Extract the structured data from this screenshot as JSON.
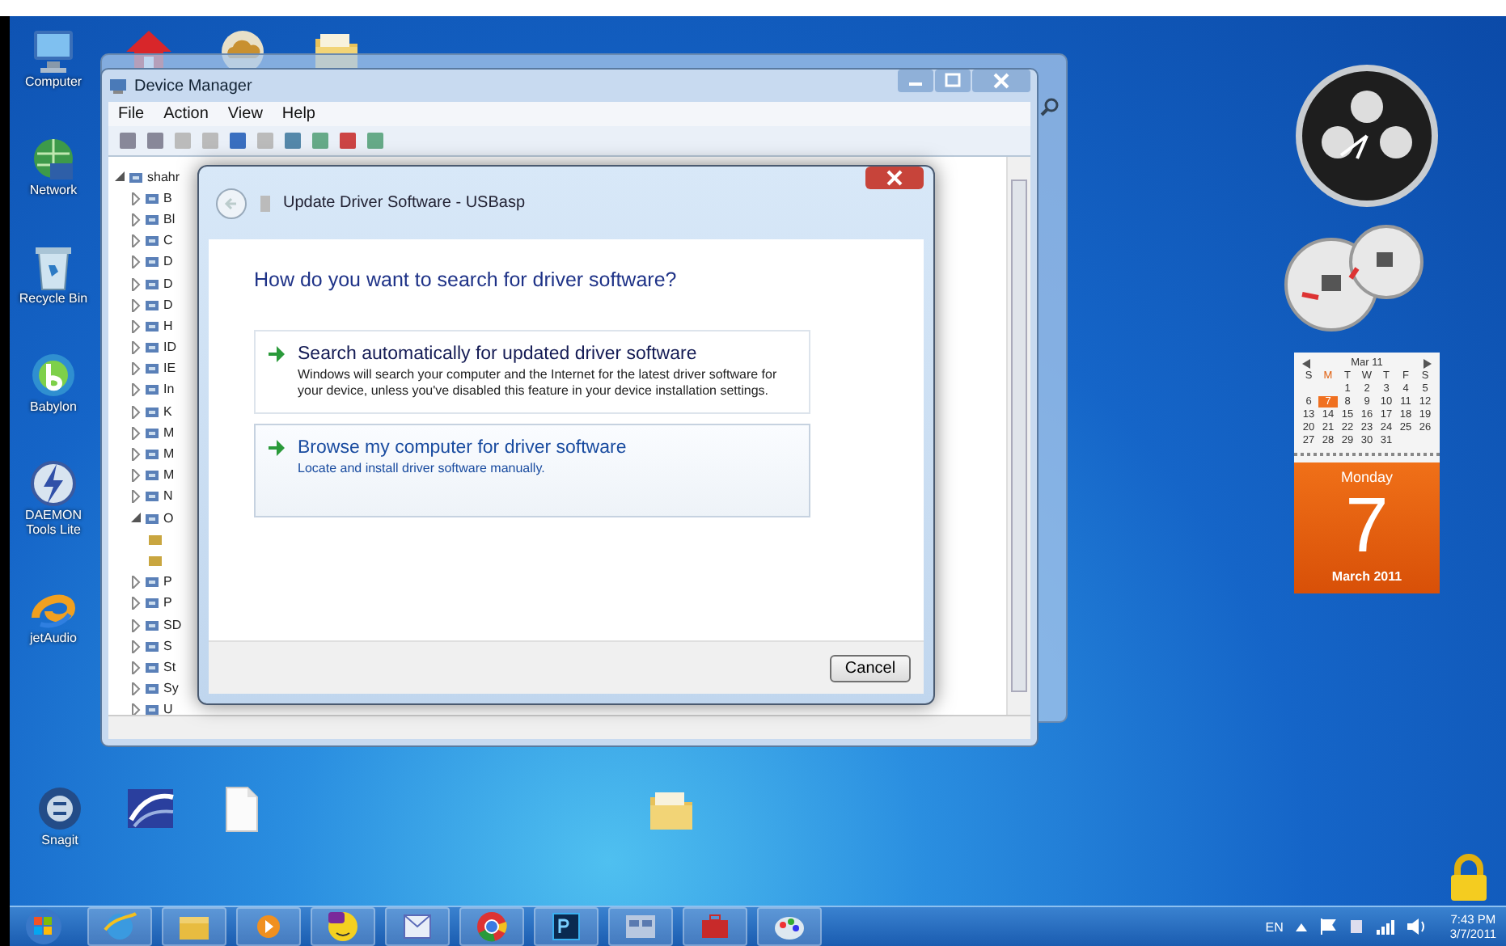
{
  "desktop_icons": [
    {
      "label": "Computer",
      "kind": "computer"
    },
    {
      "label": "Network",
      "kind": "network"
    },
    {
      "label": "Recycle Bin",
      "kind": "bin"
    },
    {
      "label": "Babylon",
      "kind": "babylon"
    },
    {
      "label": "DAEMON Tools Lite",
      "kind": "daemon"
    },
    {
      "label": "jetAudio",
      "kind": "jetaudio"
    }
  ],
  "bottom_icons": [
    {
      "label": "Snagit",
      "kind": "snagit"
    },
    {
      "kind": "arc"
    },
    {
      "kind": "file"
    }
  ],
  "folder_icon": {
    "kind": "folder"
  },
  "top_icons": [
    {
      "kind": "house"
    },
    {
      "kind": "cloud"
    },
    {
      "kind": "folder"
    }
  ],
  "device_manager": {
    "title": "Device Manager",
    "menu": [
      "File",
      "Action",
      "View",
      "Help"
    ],
    "tree": {
      "label": "shahr",
      "expanded": true,
      "children": [
        {
          "label": "B",
          "expanded": false
        },
        {
          "label": "Bl",
          "expanded": false
        },
        {
          "label": "C",
          "expanded": false
        },
        {
          "label": "D",
          "expanded": false
        },
        {
          "label": "D",
          "expanded": false
        },
        {
          "label": "D",
          "expanded": false
        },
        {
          "label": "H",
          "expanded": false
        },
        {
          "label": "ID",
          "expanded": false
        },
        {
          "label": "IE",
          "expanded": false
        },
        {
          "label": "In",
          "expanded": false
        },
        {
          "label": "K",
          "expanded": false
        },
        {
          "label": "M",
          "expanded": false
        },
        {
          "label": "M",
          "expanded": false
        },
        {
          "label": "M",
          "expanded": false
        },
        {
          "label": "N",
          "expanded": false
        },
        {
          "label": "O",
          "expanded": true,
          "children": [
            {
              "kind": "device"
            },
            {
              "kind": "device"
            }
          ]
        },
        {
          "label": "P",
          "expanded": false
        },
        {
          "label": "P",
          "expanded": false
        },
        {
          "label": "SD",
          "expanded": false
        },
        {
          "label": "S",
          "expanded": false
        },
        {
          "label": "St",
          "expanded": false
        },
        {
          "label": "Sy",
          "expanded": false
        },
        {
          "label": "U",
          "expanded": false
        }
      ]
    }
  },
  "dialog": {
    "title": "Update Driver Software - USBasp",
    "question": "How do you want to search for driver software?",
    "options": [
      {
        "title": "Search automatically for updated driver software",
        "description": "Windows will search your computer and the Internet for the latest driver software for your device, unless you've disabled this feature in your device installation settings.",
        "hovered": false
      },
      {
        "title": "Browse my computer for driver software",
        "description": "Locate and install driver software manually.",
        "hovered": true
      }
    ],
    "cancel": "Cancel"
  },
  "calendar_gadget": {
    "month": "Mar 11",
    "weekdays": [
      {
        "label": "S",
        "selected": false
      },
      {
        "label": "M",
        "selected": true
      },
      {
        "label": "T",
        "selected": false
      },
      {
        "label": "W",
        "selected": false
      },
      {
        "label": "T",
        "selected": false
      },
      {
        "label": "F",
        "selected": false
      },
      {
        "label": "S",
        "selected": false
      }
    ],
    "weeks": [
      [
        {
          "day": "1",
          "selected": false
        },
        {
          "day": "2",
          "selected": false
        },
        {
          "day": "3",
          "selected": false
        },
        {
          "day": "4",
          "selected": false
        },
        {
          "day": "5",
          "selected": false
        }
      ],
      [
        {
          "day": "6",
          "selected": false
        },
        {
          "day": "7",
          "selected": true
        },
        {
          "day": "8",
          "selected": false
        },
        {
          "day": "9",
          "selected": false
        },
        {
          "day": "10",
          "selected": false
        },
        {
          "day": "11",
          "selected": false
        },
        {
          "day": "12",
          "selected": false
        }
      ],
      [
        {
          "day": "13",
          "selected": false
        },
        {
          "day": "14",
          "selected": false
        },
        {
          "day": "15",
          "selected": false
        },
        {
          "day": "16",
          "selected": false
        },
        {
          "day": "17",
          "selected": false
        },
        {
          "day": "18",
          "selected": false
        },
        {
          "day": "19",
          "selected": false
        }
      ],
      [
        {
          "day": "20",
          "selected": false
        },
        {
          "day": "21",
          "selected": false
        },
        {
          "day": "22",
          "selected": false
        },
        {
          "day": "23",
          "selected": false
        },
        {
          "day": "24",
          "selected": false
        },
        {
          "day": "25",
          "selected": false
        },
        {
          "day": "26",
          "selected": false
        }
      ],
      [
        {
          "day": "27",
          "selected": false
        },
        {
          "day": "28",
          "selected": false
        },
        {
          "day": "29",
          "selected": false
        },
        {
          "day": "30",
          "selected": false
        },
        {
          "day": "31",
          "selected": false
        }
      ]
    ],
    "weekday_name": "Monday",
    "day": "7",
    "month_year": "March 2011"
  },
  "taskbar": {
    "apps": [
      {
        "kind": "ie"
      },
      {
        "kind": "explorer"
      },
      {
        "kind": "media"
      },
      {
        "kind": "yahoo"
      },
      {
        "kind": "outlook"
      },
      {
        "kind": "chrome"
      },
      {
        "kind": "photoshop"
      },
      {
        "kind": "window"
      },
      {
        "kind": "toolbox"
      },
      {
        "kind": "paint"
      }
    ],
    "language": "EN",
    "time": "7:43 PM",
    "date": "3/7/2011"
  }
}
